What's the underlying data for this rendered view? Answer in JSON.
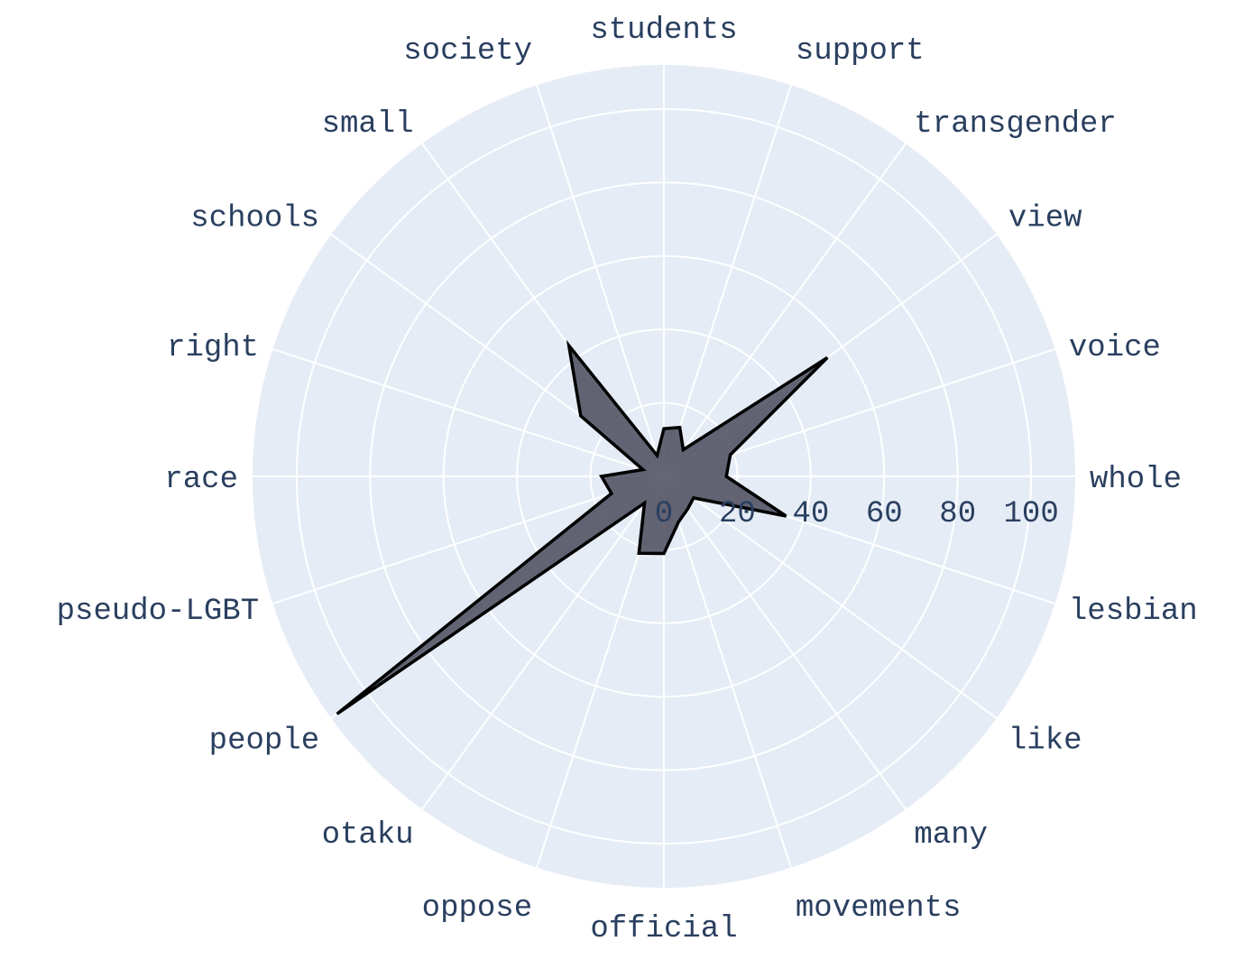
{
  "chart_data": {
    "type": "radar",
    "categories": [
      "whole",
      "voice",
      "view",
      "transgender",
      "support",
      "students",
      "society",
      "small",
      "schools",
      "right",
      "race",
      "pseudo-LGBT",
      "people",
      "otaku",
      "oppose",
      "official",
      "movements",
      "many",
      "like",
      "lesbian"
    ],
    "values": [
      17,
      19,
      55,
      9,
      14,
      13,
      6,
      44,
      28,
      6,
      17,
      15,
      110,
      9,
      22,
      21,
      13,
      11,
      10,
      35
    ],
    "radial_ticks": [
      "0",
      "20",
      "40",
      "60",
      "80",
      "100"
    ],
    "radial_range": [
      0,
      112
    ],
    "rotation_deg": 0,
    "direction": "counterclockwise",
    "grid": true,
    "colors": {
      "polar_bg": "#e5ecf6",
      "grid": "#ffffff",
      "fill": "#4a4a5a",
      "fill_opacity": 0.85,
      "line": "#000000",
      "text": "#2a3f5f"
    }
  }
}
